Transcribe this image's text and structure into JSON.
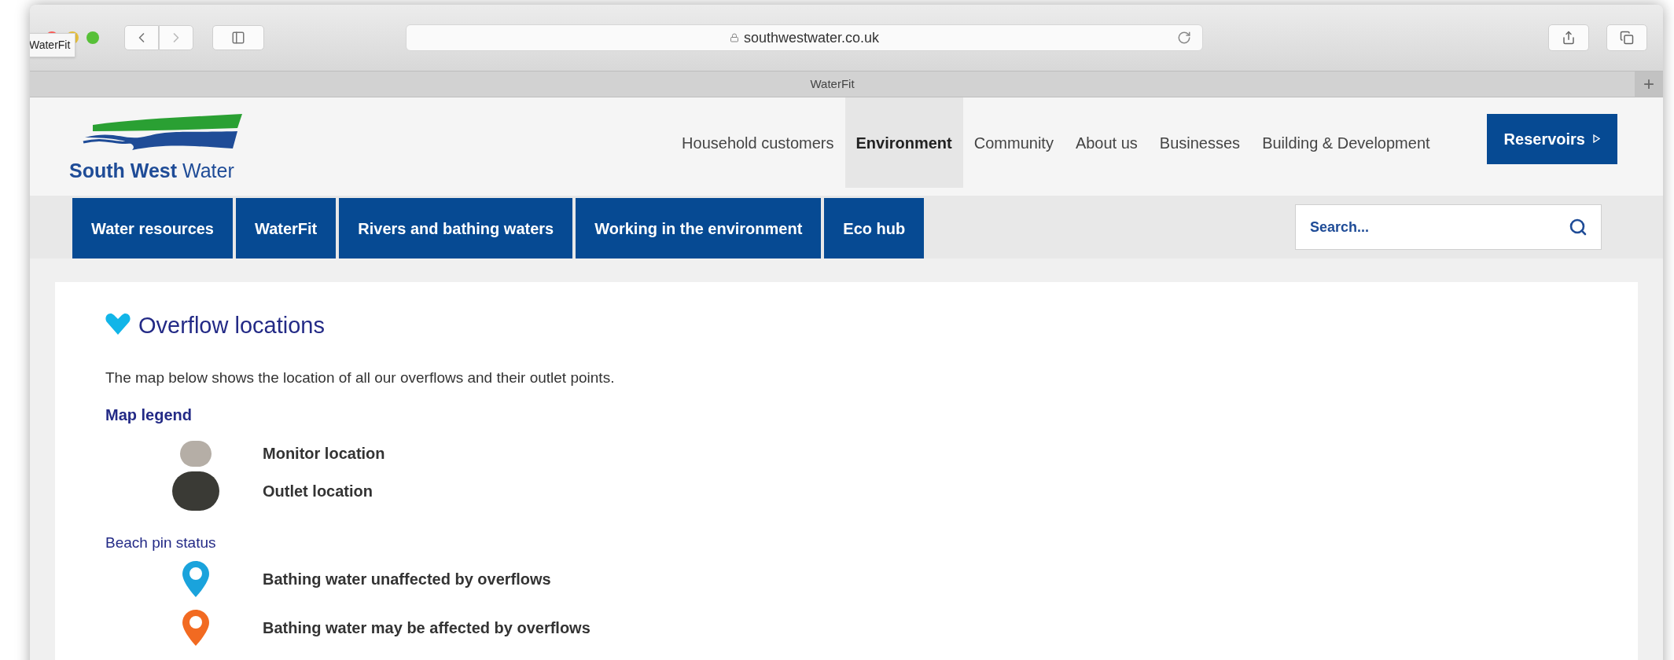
{
  "browser": {
    "tooltip": "WaterFit",
    "url": "southwestwater.co.uk",
    "tab_title": "WaterFit",
    "new_tab": "+"
  },
  "site": {
    "logo": "**South West** Water",
    "nav": [
      {
        "label": "Household customers",
        "selected": false
      },
      {
        "label": "Environment",
        "selected": true
      },
      {
        "label": "Community",
        "selected": false
      },
      {
        "label": "About us",
        "selected": false
      },
      {
        "label": "Businesses",
        "selected": false
      },
      {
        "label": "Building & Development",
        "selected": false
      }
    ],
    "cta": "Reservoirs",
    "subnav": [
      "Water resources",
      "WaterFit",
      "Rivers and bathing waters",
      "Working in the environment",
      "Eco hub"
    ],
    "search": {
      "placeholder": "Search..."
    }
  },
  "content": {
    "title": "Overflow locations",
    "intro": "The map below shows the location of all our overflows and their outlet points.",
    "legend_title": "Map legend",
    "legend": [
      {
        "kind": "dot",
        "color": "#b5aea6",
        "label": "Monitor location"
      },
      {
        "kind": "bigdot",
        "color": "#3a3a35",
        "label": "Outlet location"
      }
    ],
    "pin_title": "Beach pin status",
    "pins": [
      {
        "kind": "pin",
        "color": "#1aa3dc",
        "label": "Bathing water unaffected by overflows"
      },
      {
        "kind": "pin",
        "color": "#f26a21",
        "label": "Bathing water may be affected by overflows"
      }
    ]
  }
}
